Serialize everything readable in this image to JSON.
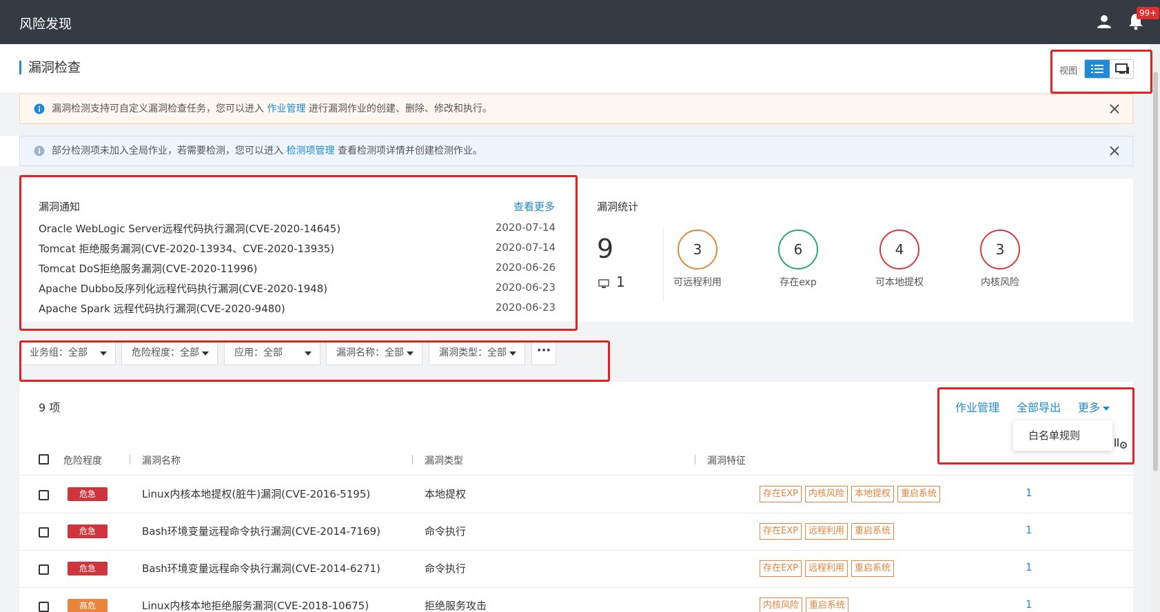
{
  "app": {
    "title": "风险发现",
    "notification_badge": "99+"
  },
  "page": {
    "title": "漏洞检查",
    "view_label": "视图"
  },
  "alerts": {
    "orange": {
      "before": "漏洞检测支持可自定义漏洞检查任务，您可以进入 ",
      "link": "作业管理",
      "after": " 进行漏洞作业的创建、删除、修改和执行。"
    },
    "blue": {
      "before": "部分检测项未加入全局作业，若需要检测，您可以进入 ",
      "link": "检测项管理",
      "after": " 查看检测项详情并创建检测作业。"
    }
  },
  "notice": {
    "title": "漏洞通知",
    "more": "查看更多",
    "items": [
      {
        "name": "Oracle WebLogic Server远程代码执行漏洞(CVE-2020-14645)",
        "date": "2020-07-14"
      },
      {
        "name": "Tomcat 拒绝服务漏洞(CVE-2020-13934、CVE-2020-13935)",
        "date": "2020-07-14"
      },
      {
        "name": "Tomcat DoS拒绝服务漏洞(CVE-2020-11996)",
        "date": "2020-06-26"
      },
      {
        "name": "Apache Dubbo反序列化远程代码执行漏洞(CVE-2020-1948)",
        "date": "2020-06-23"
      },
      {
        "name": "Apache Spark 远程代码执行漏洞(CVE-2020-9480)",
        "date": "2020-06-23"
      }
    ]
  },
  "stats": {
    "title": "漏洞统计",
    "total": "9",
    "hosts": "1",
    "items": [
      {
        "value": "3",
        "label": "可远程利用",
        "color": "#e8843b"
      },
      {
        "value": "6",
        "label": "存在exp",
        "color": "#2aa876"
      },
      {
        "value": "4",
        "label": "可本地提权",
        "color": "#d83a3a"
      },
      {
        "value": "3",
        "label": "内核风险",
        "color": "#d83a3a"
      }
    ]
  },
  "filters": [
    {
      "label": "业务组：全部"
    },
    {
      "label": "危险程度：全部"
    },
    {
      "label": "应用：全部"
    },
    {
      "label": "漏洞名称：全部"
    },
    {
      "label": "漏洞类型：全部"
    }
  ],
  "filter_more": "···",
  "table": {
    "count": "9 项",
    "toolbar": {
      "job": "作业管理",
      "export": "全部导出",
      "more": "更多"
    },
    "menu": {
      "whitelist": "白名单规则"
    },
    "headers": {
      "severity": "危险程度",
      "name": "漏洞名称",
      "type": "漏洞类型",
      "features": "漏洞特征"
    },
    "rows": [
      {
        "severity": "危急",
        "color": "#d0343c",
        "name": "Linux内核本地提权(脏牛)漏洞(CVE-2016-5195)",
        "type": "本地提权",
        "tags": [
          "存在EXP",
          "内核风险",
          "本地提权",
          "重启系统"
        ],
        "count": "1"
      },
      {
        "severity": "危急",
        "color": "#d0343c",
        "name": "Bash环境变量远程命令执行漏洞(CVE-2014-7169)",
        "type": "命令执行",
        "tags": [
          "存在EXP",
          "远程利用",
          "重启系统"
        ],
        "count": "1"
      },
      {
        "severity": "危急",
        "color": "#d0343c",
        "name": "Bash环境变量远程命令执行漏洞(CVE-2014-6271)",
        "type": "命令执行",
        "tags": [
          "存在EXP",
          "远程利用",
          "重启系统"
        ],
        "count": "1"
      },
      {
        "severity": "高危",
        "color": "#e8843b",
        "name": "Linux内核本地拒绝服务漏洞(CVE-2018-10675)",
        "type": "拒绝服务攻击",
        "tags": [
          "内核风险",
          "重启系统"
        ],
        "count": "1"
      }
    ]
  }
}
